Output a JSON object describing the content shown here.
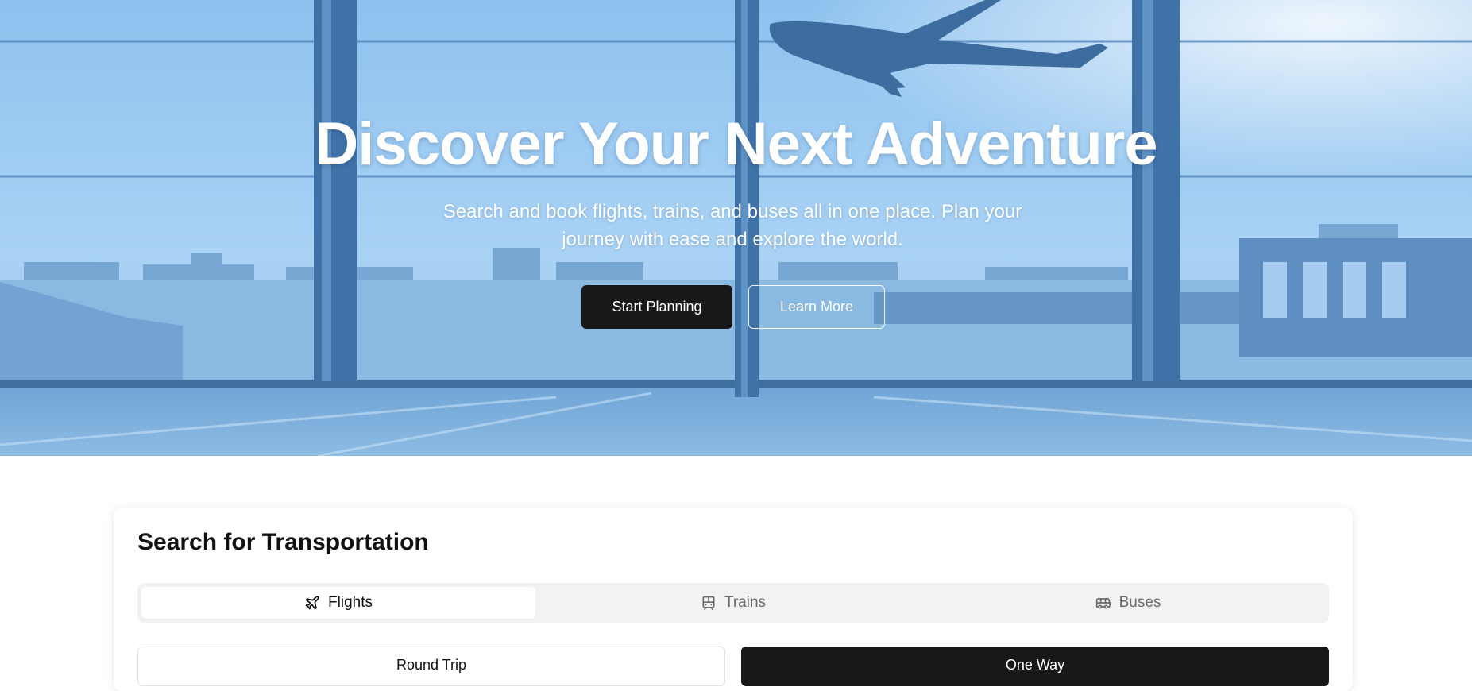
{
  "hero": {
    "title": "Discover Your Next Adventure",
    "subtitle": "Search and book flights, trains, and buses all in one place. Plan your journey with ease and explore the world.",
    "primary_cta": "Start Planning",
    "secondary_cta": "Learn More"
  },
  "search": {
    "title": "Search for Transportation",
    "tabs": [
      {
        "label": "Flights",
        "icon": "plane-icon",
        "active": true
      },
      {
        "label": "Trains",
        "icon": "train-icon",
        "active": false
      },
      {
        "label": "Buses",
        "icon": "bus-icon",
        "active": false
      }
    ],
    "trip_types": {
      "round_trip": "Round Trip",
      "one_way": "One Way",
      "selected": "one_way"
    }
  },
  "colors": {
    "hero_tint": "#7fb5e6",
    "primary_button": "#181818",
    "tab_bar": "#f2f2f2"
  }
}
